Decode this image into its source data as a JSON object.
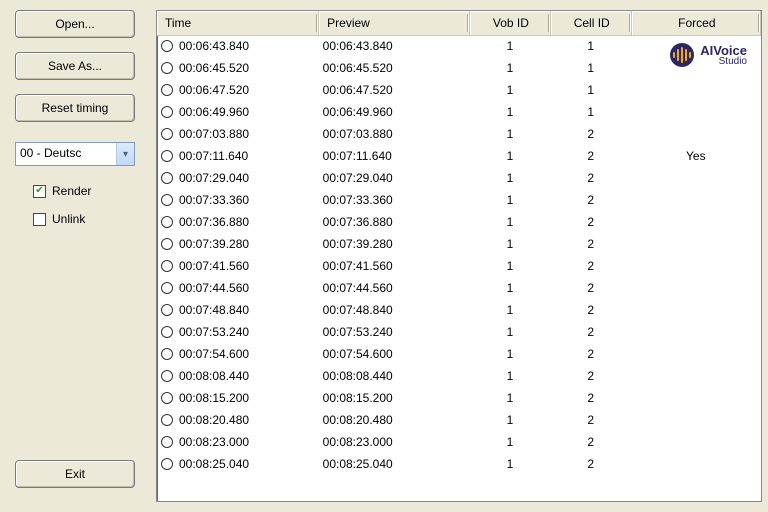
{
  "sidebar": {
    "open": "Open...",
    "saveAs": "Save As...",
    "resetTiming": "Reset timing",
    "exit": "Exit",
    "langSelected": "00 - Deutsc",
    "renderLabel": "Render",
    "renderChecked": true,
    "unlinkLabel": "Unlink",
    "unlinkChecked": false
  },
  "table": {
    "headers": {
      "time": "Time",
      "preview": "Preview",
      "vob": "Vob ID",
      "cell": "Cell ID",
      "forced": "Forced"
    },
    "rows": [
      {
        "time": "00:06:43.840",
        "preview": "00:06:43.840",
        "vob": 1,
        "cell": 1,
        "forced": ""
      },
      {
        "time": "00:06:45.520",
        "preview": "00:06:45.520",
        "vob": 1,
        "cell": 1,
        "forced": ""
      },
      {
        "time": "00:06:47.520",
        "preview": "00:06:47.520",
        "vob": 1,
        "cell": 1,
        "forced": ""
      },
      {
        "time": "00:06:49.960",
        "preview": "00:06:49.960",
        "vob": 1,
        "cell": 1,
        "forced": ""
      },
      {
        "time": "00:07:03.880",
        "preview": "00:07:03.880",
        "vob": 1,
        "cell": 2,
        "forced": ""
      },
      {
        "time": "00:07:11.640",
        "preview": "00:07:11.640",
        "vob": 1,
        "cell": 2,
        "forced": "Yes"
      },
      {
        "time": "00:07:29.040",
        "preview": "00:07:29.040",
        "vob": 1,
        "cell": 2,
        "forced": ""
      },
      {
        "time": "00:07:33.360",
        "preview": "00:07:33.360",
        "vob": 1,
        "cell": 2,
        "forced": ""
      },
      {
        "time": "00:07:36.880",
        "preview": "00:07:36.880",
        "vob": 1,
        "cell": 2,
        "forced": ""
      },
      {
        "time": "00:07:39.280",
        "preview": "00:07:39.280",
        "vob": 1,
        "cell": 2,
        "forced": ""
      },
      {
        "time": "00:07:41.560",
        "preview": "00:07:41.560",
        "vob": 1,
        "cell": 2,
        "forced": ""
      },
      {
        "time": "00:07:44.560",
        "preview": "00:07:44.560",
        "vob": 1,
        "cell": 2,
        "forced": ""
      },
      {
        "time": "00:07:48.840",
        "preview": "00:07:48.840",
        "vob": 1,
        "cell": 2,
        "forced": ""
      },
      {
        "time": "00:07:53.240",
        "preview": "00:07:53.240",
        "vob": 1,
        "cell": 2,
        "forced": ""
      },
      {
        "time": "00:07:54.600",
        "preview": "00:07:54.600",
        "vob": 1,
        "cell": 2,
        "forced": ""
      },
      {
        "time": "00:08:08.440",
        "preview": "00:08:08.440",
        "vob": 1,
        "cell": 2,
        "forced": ""
      },
      {
        "time": "00:08:15.200",
        "preview": "00:08:15.200",
        "vob": 1,
        "cell": 2,
        "forced": ""
      },
      {
        "time": "00:08:20.480",
        "preview": "00:08:20.480",
        "vob": 1,
        "cell": 2,
        "forced": ""
      },
      {
        "time": "00:08:23.000",
        "preview": "00:08:23.000",
        "vob": 1,
        "cell": 2,
        "forced": ""
      },
      {
        "time": "00:08:25.040",
        "preview": "00:08:25.040",
        "vob": 1,
        "cell": 2,
        "forced": ""
      }
    ]
  },
  "brand": {
    "line1": "AIVoice",
    "line2": "Studio"
  }
}
